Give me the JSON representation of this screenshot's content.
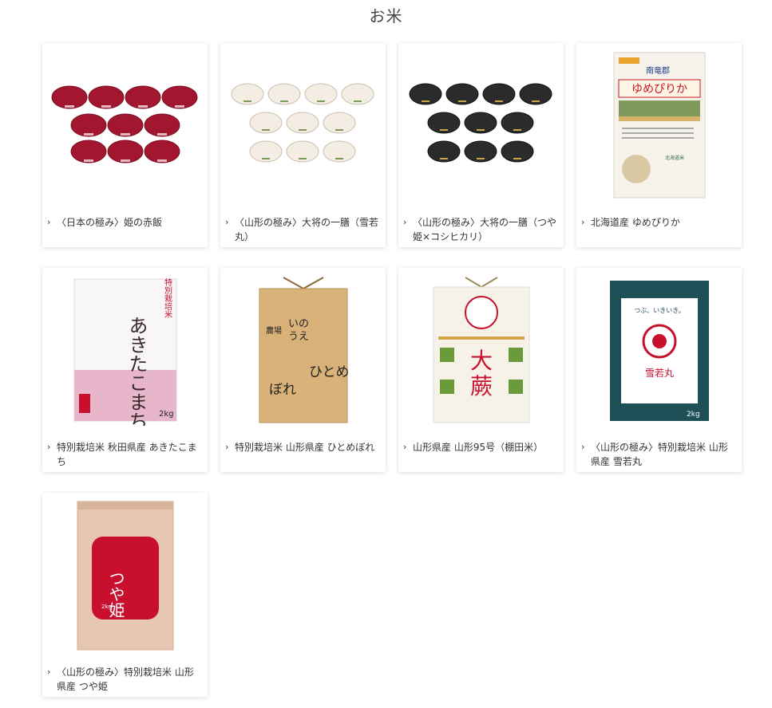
{
  "page": {
    "title": "お米"
  },
  "products": [
    {
      "label": "〈日本の極み〉姫の赤飯",
      "icon": "red-rice-bowl-pack-image"
    },
    {
      "label": "〈山形の極み〉大将の一膳（雪若丸）",
      "icon": "white-rice-bowl-pack-image"
    },
    {
      "label": "〈山形の極み〉大将の一膳（つや姫×コシヒカリ）",
      "icon": "black-rice-bowl-pack-image"
    },
    {
      "label": "北海道産 ゆめぴりか",
      "icon": "yumepirika-rice-bag-image"
    },
    {
      "label": "特別栽培米 秋田県産 あきたこまち",
      "icon": "akitakomachi-rice-bag-image"
    },
    {
      "label": "特別栽培米 山形県産 ひとめぼれ",
      "icon": "hitomebore-rice-bag-image"
    },
    {
      "label": "山形県産 山形95号（棚田米）",
      "icon": "yamagata95-rice-bag-image"
    },
    {
      "label": "〈山形の極み〉特別栽培米 山形県産 雪若丸",
      "icon": "yukiwakamaru-rice-bag-image"
    },
    {
      "label": "〈山形の極み〉特別栽培米 山形県産 つや姫",
      "icon": "tsuyahime-rice-bag-image"
    }
  ],
  "package_text": {
    "yumepirika_maker": "南竜郡",
    "yumepirika_name": "ゆめぴりか",
    "akita_badge": "特別栽培米",
    "akita_name": "あきたこまち",
    "akita_weight": "2kg",
    "hitome_lines": [
      "いの",
      "うえ",
      "農場",
      "ひとめ",
      "ぼれ"
    ],
    "yama95_chars": [
      "大",
      "蕨"
    ],
    "yuki_tag": "つぶ、いきいき。",
    "yuki_name": "雪若丸",
    "yuki_weight": "2kg",
    "tsuya_name": "つや姫",
    "tsuya_weight": "2kg"
  },
  "colors": {
    "card_bg": "#ffffff",
    "text": "#333333",
    "accent_red": "#c8102e"
  }
}
